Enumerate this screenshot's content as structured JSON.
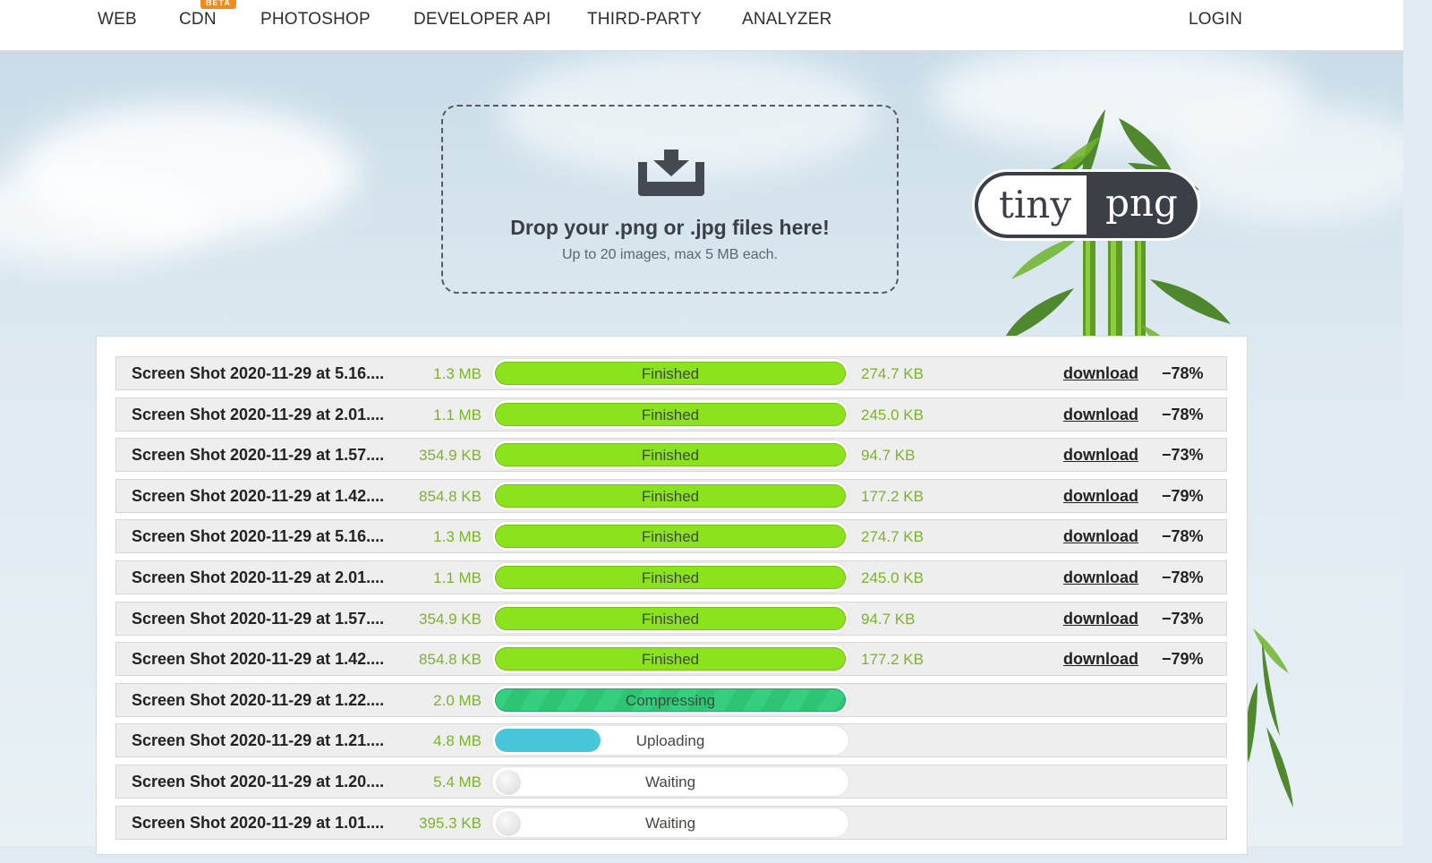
{
  "nav": {
    "items": [
      "WEB",
      "CDN",
      "PHOTOSHOP",
      "DEVELOPER API",
      "THIRD-PARTY",
      "ANALYZER"
    ],
    "badge": "BETA",
    "login": "LOGIN"
  },
  "dropzone": {
    "icon": "download-tray-icon",
    "title": "Drop your .png or .jpg files here!",
    "subtitle": "Up to 20 images, max 5 MB each."
  },
  "logo": {
    "left": "tiny",
    "right": "png"
  },
  "colors": {
    "finished": "#8ae31c",
    "compressing": "#35cf7f",
    "uploading": "#48c6da",
    "size_text": "#7bb42a"
  },
  "files": [
    {
      "name": "Screen Shot 2020-11-29 at 5.16....",
      "original": "1.3 MB",
      "status": "Finished",
      "progress": 1.0,
      "compressed": "274.7 KB",
      "action": "download",
      "saving": "−78%"
    },
    {
      "name": "Screen Shot 2020-11-29 at 2.01....",
      "original": "1.1 MB",
      "status": "Finished",
      "progress": 1.0,
      "compressed": "245.0 KB",
      "action": "download",
      "saving": "−78%"
    },
    {
      "name": "Screen Shot 2020-11-29 at 1.57....",
      "original": "354.9 KB",
      "status": "Finished",
      "progress": 1.0,
      "compressed": "94.7 KB",
      "action": "download",
      "saving": "−73%"
    },
    {
      "name": "Screen Shot 2020-11-29 at 1.42....",
      "original": "854.8 KB",
      "status": "Finished",
      "progress": 1.0,
      "compressed": "177.2 KB",
      "action": "download",
      "saving": "−79%"
    },
    {
      "name": "Screen Shot 2020-11-29 at 5.16....",
      "original": "1.3 MB",
      "status": "Finished",
      "progress": 1.0,
      "compressed": "274.7 KB",
      "action": "download",
      "saving": "−78%"
    },
    {
      "name": "Screen Shot 2020-11-29 at 2.01....",
      "original": "1.1 MB",
      "status": "Finished",
      "progress": 1.0,
      "compressed": "245.0 KB",
      "action": "download",
      "saving": "−78%"
    },
    {
      "name": "Screen Shot 2020-11-29 at 1.57....",
      "original": "354.9 KB",
      "status": "Finished",
      "progress": 1.0,
      "compressed": "94.7 KB",
      "action": "download",
      "saving": "−73%"
    },
    {
      "name": "Screen Shot 2020-11-29 at 1.42....",
      "original": "854.8 KB",
      "status": "Finished",
      "progress": 1.0,
      "compressed": "177.2 KB",
      "action": "download",
      "saving": "−79%"
    },
    {
      "name": "Screen Shot 2020-11-29 at 1.22....",
      "original": "2.0 MB",
      "status": "Compressing",
      "progress": 1.0,
      "compressed": "",
      "action": "",
      "saving": ""
    },
    {
      "name": "Screen Shot 2020-11-29 at 1.21....",
      "original": "4.8 MB",
      "status": "Uploading",
      "progress": 0.3,
      "compressed": "",
      "action": "",
      "saving": ""
    },
    {
      "name": "Screen Shot 2020-11-29 at 1.20....",
      "original": "5.4 MB",
      "status": "Waiting",
      "progress": 0,
      "compressed": "",
      "action": "",
      "saving": ""
    },
    {
      "name": "Screen Shot 2020-11-29 at 1.01....",
      "original": "395.3 KB",
      "status": "Waiting",
      "progress": 0,
      "compressed": "",
      "action": "",
      "saving": ""
    }
  ]
}
